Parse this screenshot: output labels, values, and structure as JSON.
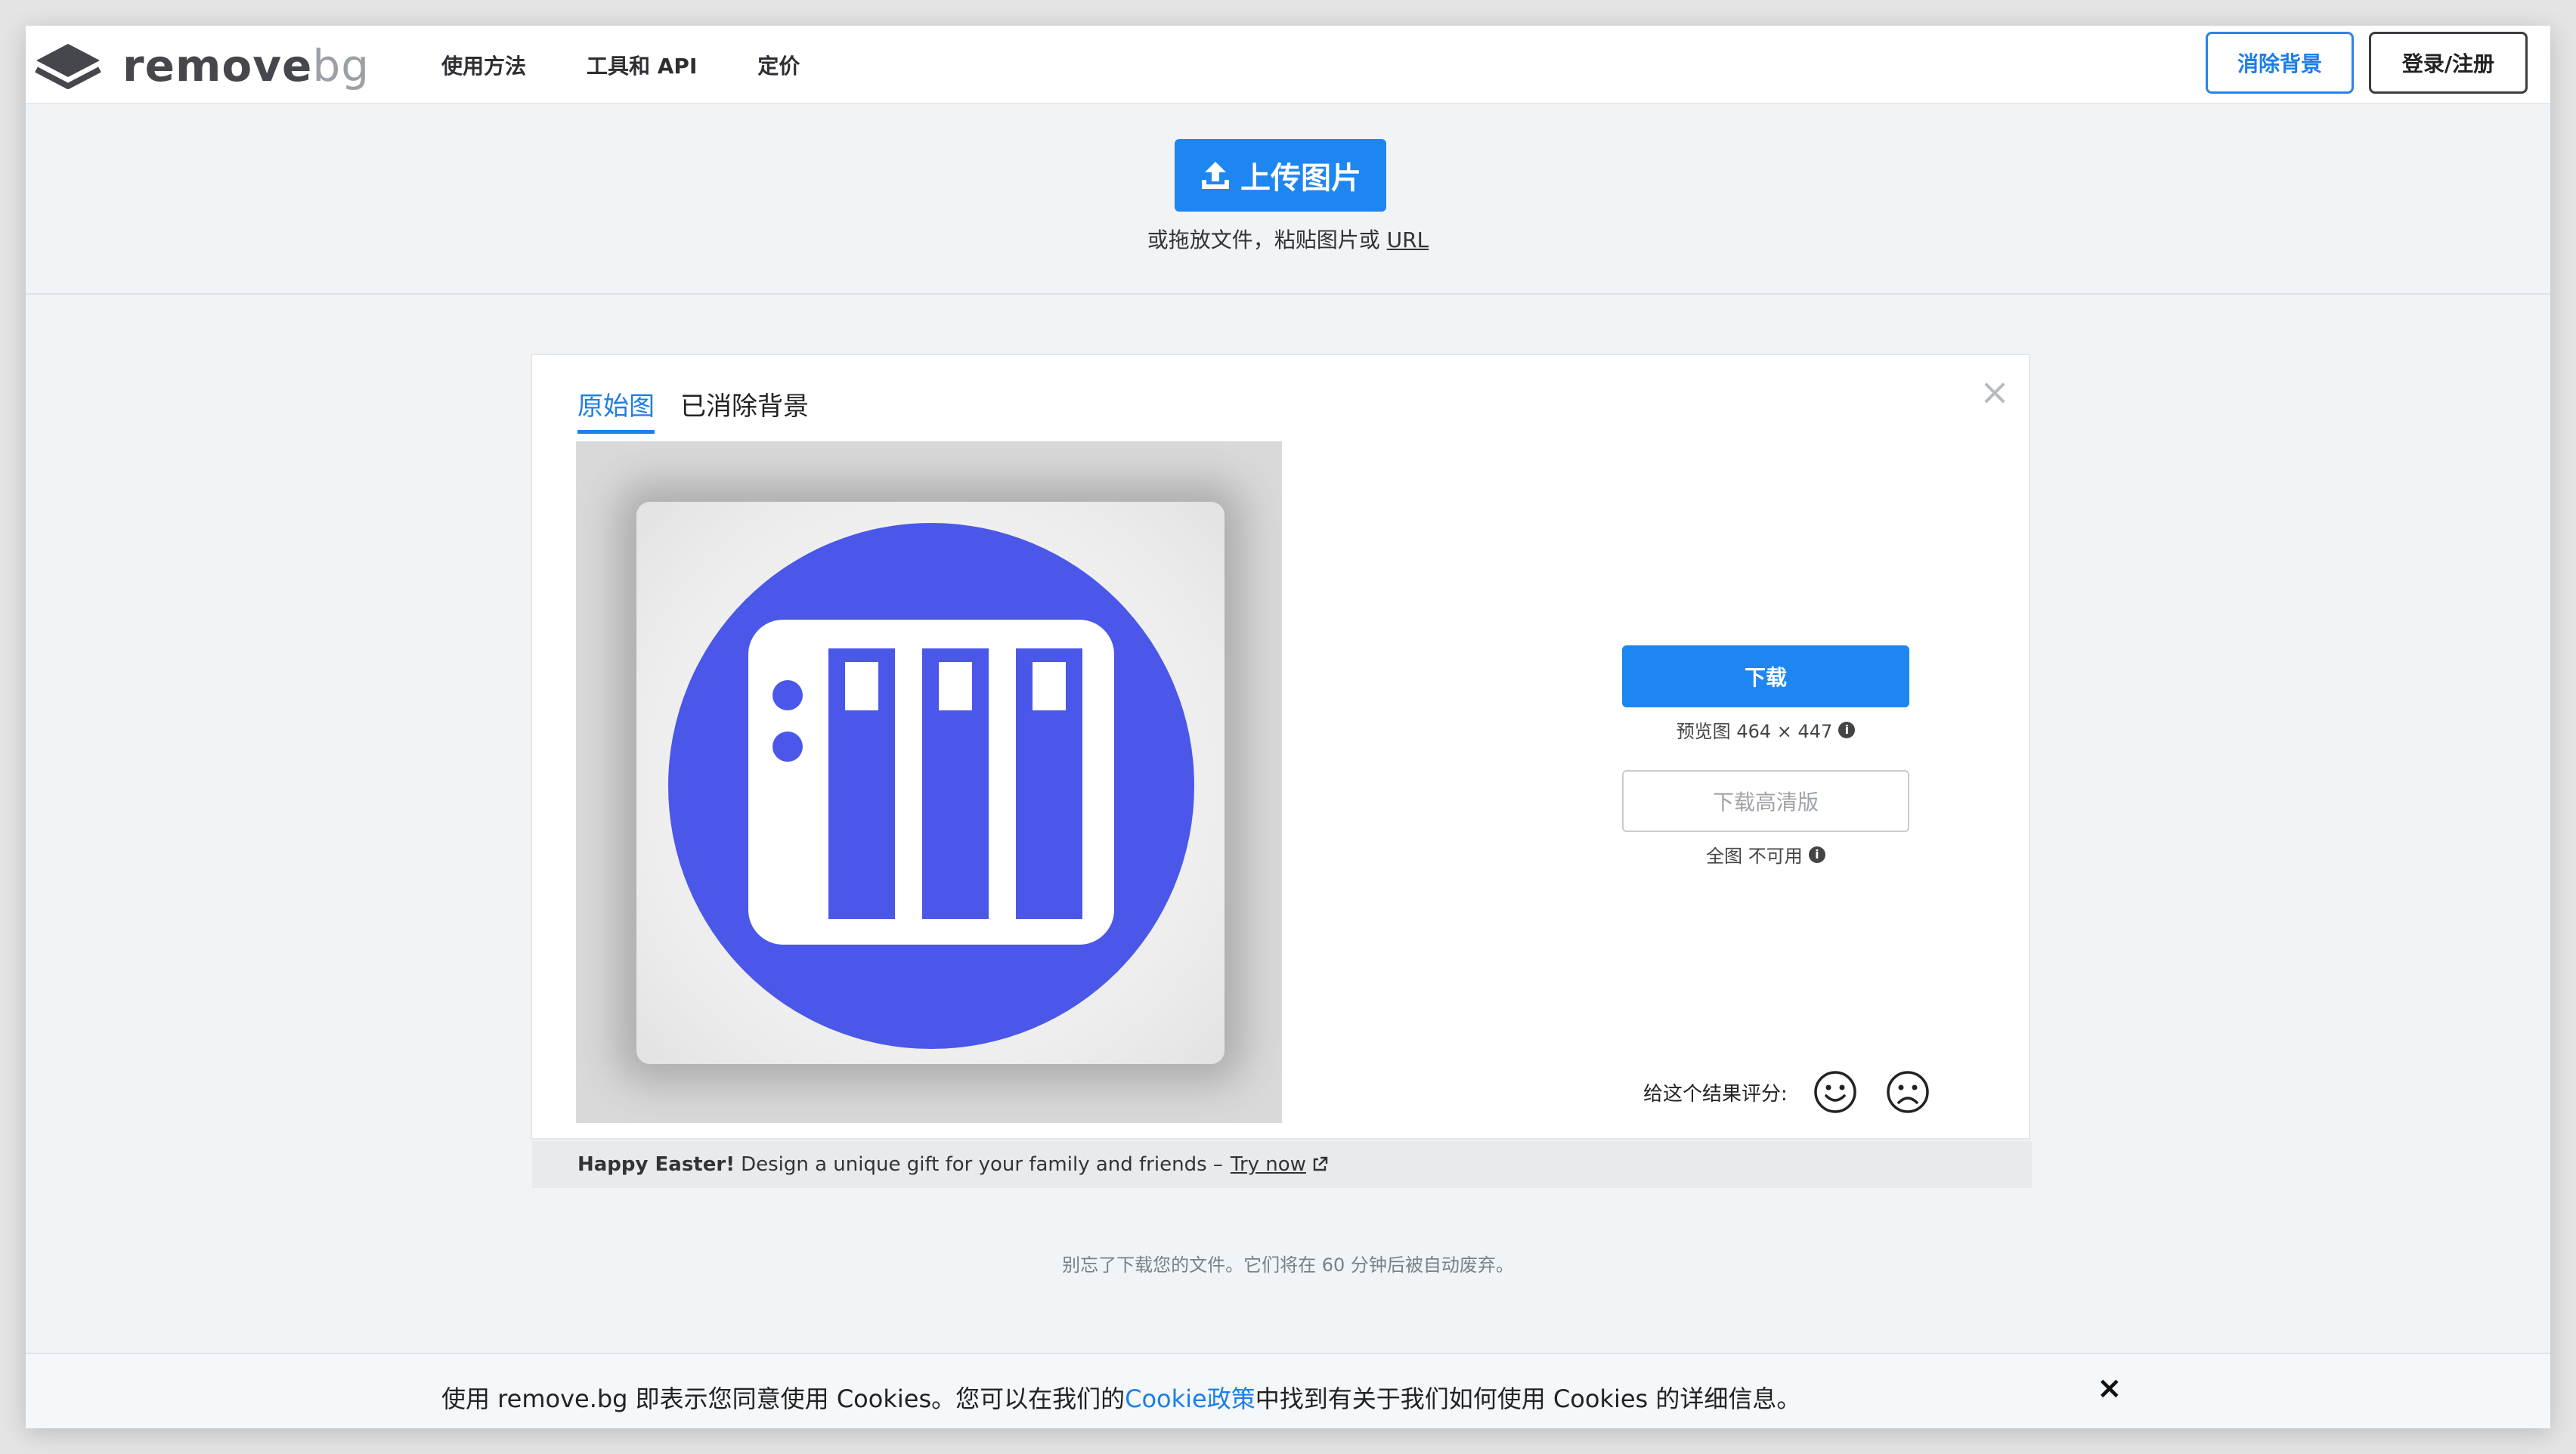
{
  "brand": {
    "name_main": "remove",
    "name_suffix": "bg"
  },
  "nav": {
    "links": [
      "使用方法",
      "工具和 API",
      "定价"
    ],
    "remove_bg_button": "消除背景",
    "login_button": "登录/注册"
  },
  "upload": {
    "button_label": "上传图片",
    "hint_prefix": "或拖放文件，粘贴图片或 ",
    "hint_link": "URL"
  },
  "result": {
    "tabs": [
      {
        "label": "原始图",
        "active": true
      },
      {
        "label": "已消除背景",
        "active": false
      }
    ],
    "close_symbol": "×",
    "download_label": "下载",
    "preview_info": "预览图 464 × 447",
    "download_hd_label": "下载高清版",
    "hd_info": "全图 不可用",
    "info_symbol": "i",
    "rating_label": "给这个结果评分:",
    "promo_bold": "Happy Easter!",
    "promo_text": "Design a unique gift for your family and friends –",
    "promo_link": "Try now"
  },
  "reminder": "别忘了下载您的文件。它们将在 60 分钟后被自动废弃。",
  "cookie": {
    "text_before": "使用 remove.bg 即表示您同意使用 Cookies。您可以在我们的",
    "link": "Cookie政策",
    "text_after": "中找到有关于我们如何使用 Cookies 的详细信息。",
    "close_symbol": "×"
  },
  "colors": {
    "accent": "#1e86f0",
    "image_circle": "#4b57e8"
  }
}
